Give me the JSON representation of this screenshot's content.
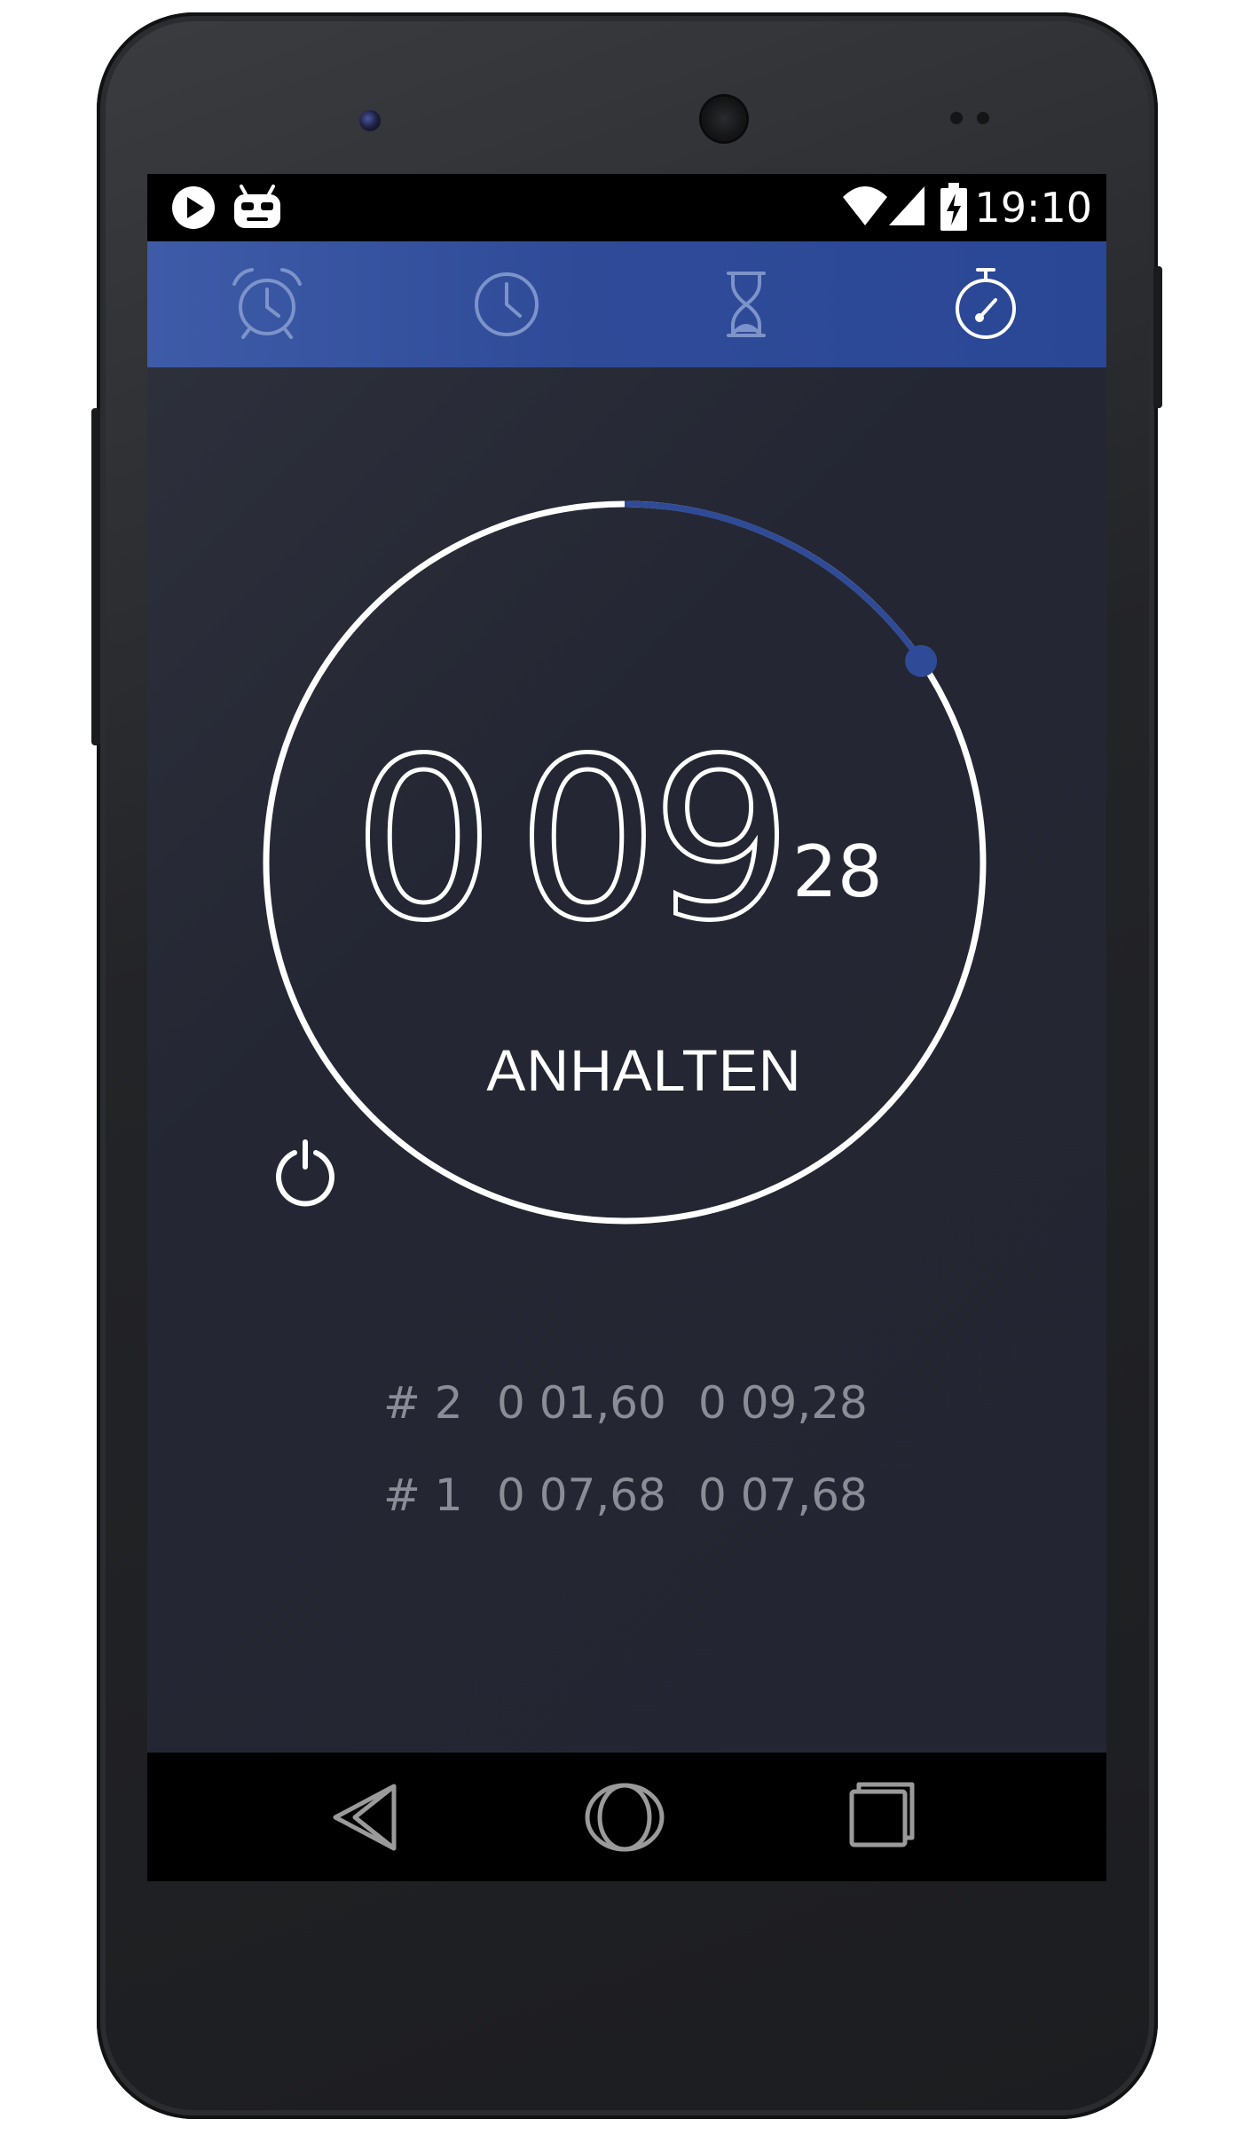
{
  "status_bar": {
    "time": "19:10",
    "left_icons": [
      "play-store-notification-icon",
      "cyanogenmod-notification-icon"
    ],
    "right_icons": [
      "wifi-icon",
      "cell-signal-icon",
      "battery-charging-icon"
    ]
  },
  "tabs": [
    {
      "icon": "alarm-clock-icon",
      "selected": false
    },
    {
      "icon": "clock-icon",
      "selected": false
    },
    {
      "icon": "hourglass-icon",
      "selected": false
    },
    {
      "icon": "stopwatch-icon",
      "selected": true
    }
  ],
  "stopwatch": {
    "minutes": "0",
    "seconds": "09",
    "hundredths": "28",
    "action_label": "ANHALTEN",
    "progress_fraction": 0.155,
    "ring_color": "#ffffff",
    "progress_color": "#2f4b98"
  },
  "laps": [
    {
      "number": "# 2",
      "lap_time": "0 01,60",
      "total_time": "0 09,28"
    },
    {
      "number": "# 1",
      "lap_time": "0 07,68",
      "total_time": "0 07,68"
    }
  ],
  "nav": {
    "buttons": [
      "back-icon",
      "home-icon",
      "recents-icon"
    ]
  },
  "colors": {
    "accent": "#2f4b98",
    "background": "#242733",
    "lap_text": "#8a8d96"
  }
}
